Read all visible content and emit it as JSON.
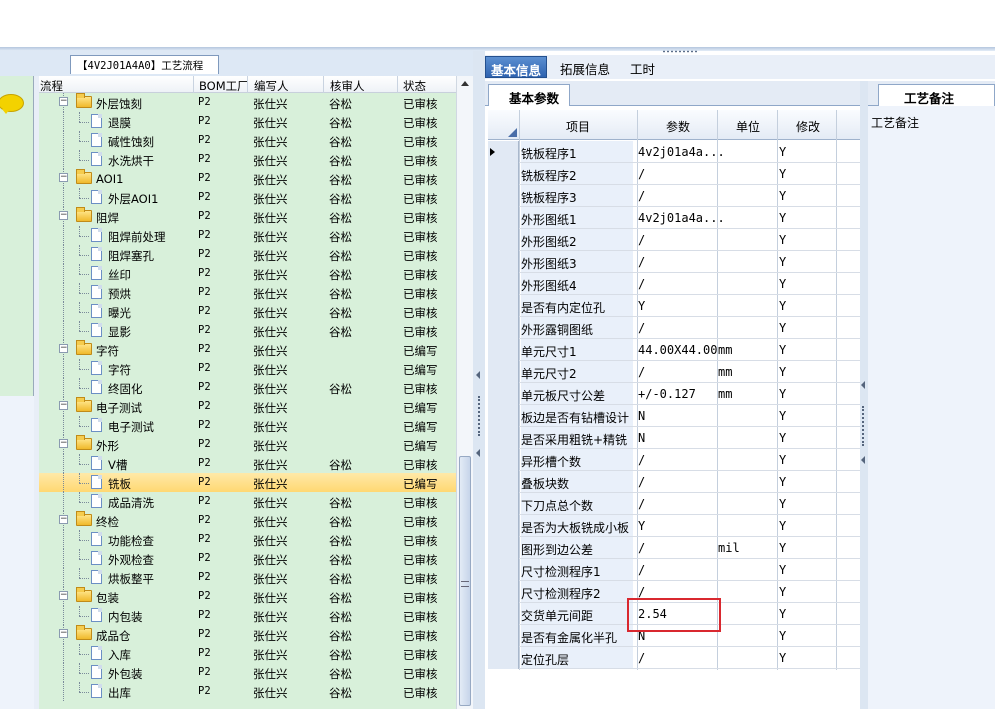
{
  "flow_tab": "【4V2J01A4A0】工艺流程",
  "tree": {
    "headers": [
      "流程",
      "BOM工厂",
      "编写人",
      "核审人",
      "状态"
    ],
    "rows": [
      {
        "label": "外层蚀刻",
        "level": 0,
        "folder": true,
        "expanded": true,
        "bom": "P2",
        "author": "张仕兴",
        "reviewer": "谷松",
        "status": "已审核"
      },
      {
        "label": "退膜",
        "level": 1,
        "folder": false,
        "bom": "P2",
        "author": "张仕兴",
        "reviewer": "谷松",
        "status": "已审核"
      },
      {
        "label": "碱性蚀刻",
        "level": 1,
        "folder": false,
        "bom": "P2",
        "author": "张仕兴",
        "reviewer": "谷松",
        "status": "已审核"
      },
      {
        "label": "水洗烘干",
        "level": 1,
        "folder": false,
        "bom": "P2",
        "author": "张仕兴",
        "reviewer": "谷松",
        "status": "已审核"
      },
      {
        "label": "AOI1",
        "level": 0,
        "folder": true,
        "expanded": true,
        "bom": "P2",
        "author": "张仕兴",
        "reviewer": "谷松",
        "status": "已审核"
      },
      {
        "label": "外层AOI1",
        "level": 1,
        "folder": false,
        "bom": "P2",
        "author": "张仕兴",
        "reviewer": "谷松",
        "status": "已审核"
      },
      {
        "label": "阻焊",
        "level": 0,
        "folder": true,
        "expanded": true,
        "bom": "P2",
        "author": "张仕兴",
        "reviewer": "谷松",
        "status": "已审核"
      },
      {
        "label": "阻焊前处理",
        "level": 1,
        "folder": false,
        "bom": "P2",
        "author": "张仕兴",
        "reviewer": "谷松",
        "status": "已审核"
      },
      {
        "label": "阻焊塞孔",
        "level": 1,
        "folder": false,
        "bom": "P2",
        "author": "张仕兴",
        "reviewer": "谷松",
        "status": "已审核"
      },
      {
        "label": "丝印",
        "level": 1,
        "folder": false,
        "bom": "P2",
        "author": "张仕兴",
        "reviewer": "谷松",
        "status": "已审核"
      },
      {
        "label": "预烘",
        "level": 1,
        "folder": false,
        "bom": "P2",
        "author": "张仕兴",
        "reviewer": "谷松",
        "status": "已审核"
      },
      {
        "label": "曝光",
        "level": 1,
        "folder": false,
        "bom": "P2",
        "author": "张仕兴",
        "reviewer": "谷松",
        "status": "已审核"
      },
      {
        "label": "显影",
        "level": 1,
        "folder": false,
        "bom": "P2",
        "author": "张仕兴",
        "reviewer": "谷松",
        "status": "已审核"
      },
      {
        "label": "字符",
        "level": 0,
        "folder": true,
        "expanded": true,
        "bom": "P2",
        "author": "张仕兴",
        "reviewer": "",
        "status": "已编写"
      },
      {
        "label": "字符",
        "level": 1,
        "folder": false,
        "bom": "P2",
        "author": "张仕兴",
        "reviewer": "",
        "status": "已编写"
      },
      {
        "label": "终固化",
        "level": 1,
        "folder": false,
        "bom": "P2",
        "author": "张仕兴",
        "reviewer": "谷松",
        "status": "已审核"
      },
      {
        "label": "电子测试",
        "level": 0,
        "folder": true,
        "expanded": true,
        "bom": "P2",
        "author": "张仕兴",
        "reviewer": "",
        "status": "已编写"
      },
      {
        "label": "电子测试",
        "level": 1,
        "folder": false,
        "bom": "P2",
        "author": "张仕兴",
        "reviewer": "",
        "status": "已编写"
      },
      {
        "label": "外形",
        "level": 0,
        "folder": true,
        "expanded": true,
        "bom": "P2",
        "author": "张仕兴",
        "reviewer": "",
        "status": "已编写"
      },
      {
        "label": "V槽",
        "level": 1,
        "folder": false,
        "bom": "P2",
        "author": "张仕兴",
        "reviewer": "谷松",
        "status": "已审核"
      },
      {
        "label": "铣板",
        "level": 1,
        "folder": false,
        "selected": true,
        "bom": "P2",
        "author": "张仕兴",
        "reviewer": "",
        "status": "已编写"
      },
      {
        "label": "成品清洗",
        "level": 1,
        "folder": false,
        "bom": "P2",
        "author": "张仕兴",
        "reviewer": "谷松",
        "status": "已审核"
      },
      {
        "label": "终检",
        "level": 0,
        "folder": true,
        "expanded": true,
        "bom": "P2",
        "author": "张仕兴",
        "reviewer": "谷松",
        "status": "已审核"
      },
      {
        "label": "功能检查",
        "level": 1,
        "folder": false,
        "bom": "P2",
        "author": "张仕兴",
        "reviewer": "谷松",
        "status": "已审核"
      },
      {
        "label": "外观检查",
        "level": 1,
        "folder": false,
        "bom": "P2",
        "author": "张仕兴",
        "reviewer": "谷松",
        "status": "已审核"
      },
      {
        "label": "烘板整平",
        "level": 1,
        "folder": false,
        "bom": "P2",
        "author": "张仕兴",
        "reviewer": "谷松",
        "status": "已审核"
      },
      {
        "label": "包装",
        "level": 0,
        "folder": true,
        "expanded": true,
        "bom": "P2",
        "author": "张仕兴",
        "reviewer": "谷松",
        "status": "已审核"
      },
      {
        "label": "内包装",
        "level": 1,
        "folder": false,
        "bom": "P2",
        "author": "张仕兴",
        "reviewer": "谷松",
        "status": "已审核"
      },
      {
        "label": "成品仓",
        "level": 0,
        "folder": true,
        "expanded": true,
        "bom": "P2",
        "author": "张仕兴",
        "reviewer": "谷松",
        "status": "已审核"
      },
      {
        "label": "入库",
        "level": 1,
        "folder": false,
        "bom": "P2",
        "author": "张仕兴",
        "reviewer": "谷松",
        "status": "已审核"
      },
      {
        "label": "外包装",
        "level": 1,
        "folder": false,
        "bom": "P2",
        "author": "张仕兴",
        "reviewer": "谷松",
        "status": "已审核"
      },
      {
        "label": "出库",
        "level": 1,
        "folder": false,
        "bom": "P2",
        "author": "张仕兴",
        "reviewer": "谷松",
        "status": "已审核"
      }
    ]
  },
  "right_tabs": [
    "基本信息",
    "拓展信息",
    "工时"
  ],
  "sub_tab": "基本参数",
  "grid": {
    "headers": [
      "项目",
      "参数",
      "单位",
      "修改"
    ],
    "rows": [
      {
        "item": "铣板程序1",
        "param": "4v2j01a4a...",
        "unit": "",
        "modify": "Y",
        "current": true
      },
      {
        "item": "铣板程序2",
        "param": "/",
        "unit": "",
        "modify": "Y"
      },
      {
        "item": "铣板程序3",
        "param": "/",
        "unit": "",
        "modify": "Y"
      },
      {
        "item": "外形图纸1",
        "param": "4v2j01a4a...",
        "unit": "",
        "modify": "Y"
      },
      {
        "item": "外形图纸2",
        "param": "/",
        "unit": "",
        "modify": "Y"
      },
      {
        "item": "外形图纸3",
        "param": "/",
        "unit": "",
        "modify": "Y"
      },
      {
        "item": "外形图纸4",
        "param": "/",
        "unit": "",
        "modify": "Y"
      },
      {
        "item": "是否有内定位孔",
        "param": "Y",
        "unit": "",
        "modify": "Y"
      },
      {
        "item": "外形露铜图纸",
        "param": "/",
        "unit": "",
        "modify": "Y"
      },
      {
        "item": "单元尺寸1",
        "param": "44.00X44.00",
        "unit": "mm",
        "modify": "Y"
      },
      {
        "item": "单元尺寸2",
        "param": "/",
        "unit": "mm",
        "modify": "Y"
      },
      {
        "item": "单元板尺寸公差",
        "param": "+/-0.127",
        "unit": "mm",
        "modify": "Y"
      },
      {
        "item": "板边是否有钻槽设计",
        "param": "N",
        "unit": "",
        "modify": "Y"
      },
      {
        "item": "是否采用粗铣+精铣",
        "param": "N",
        "unit": "",
        "modify": "Y"
      },
      {
        "item": "异形槽个数",
        "param": "/",
        "unit": "",
        "modify": "Y"
      },
      {
        "item": "叠板块数",
        "param": "/",
        "unit": "",
        "modify": "Y"
      },
      {
        "item": "下刀点总个数",
        "param": "/",
        "unit": "",
        "modify": "Y"
      },
      {
        "item": "是否为大板铣成小板",
        "param": "Y",
        "unit": "",
        "modify": "Y"
      },
      {
        "item": "图形到边公差",
        "param": "/",
        "unit": "mil",
        "modify": "Y"
      },
      {
        "item": "尺寸检测程序1",
        "param": "/",
        "unit": "",
        "modify": "Y"
      },
      {
        "item": "尺寸检测程序2",
        "param": "/",
        "unit": "",
        "modify": "Y"
      },
      {
        "item": "交货单元间距",
        "param": "2.54",
        "unit": "",
        "modify": "Y"
      },
      {
        "item": "是否有金属化半孔",
        "param": "N",
        "unit": "",
        "modify": "Y"
      },
      {
        "item": "定位孔层",
        "param": "/",
        "unit": "",
        "modify": "Y"
      }
    ]
  },
  "remark_tab": "工艺备注",
  "remark_label": "工艺备注"
}
